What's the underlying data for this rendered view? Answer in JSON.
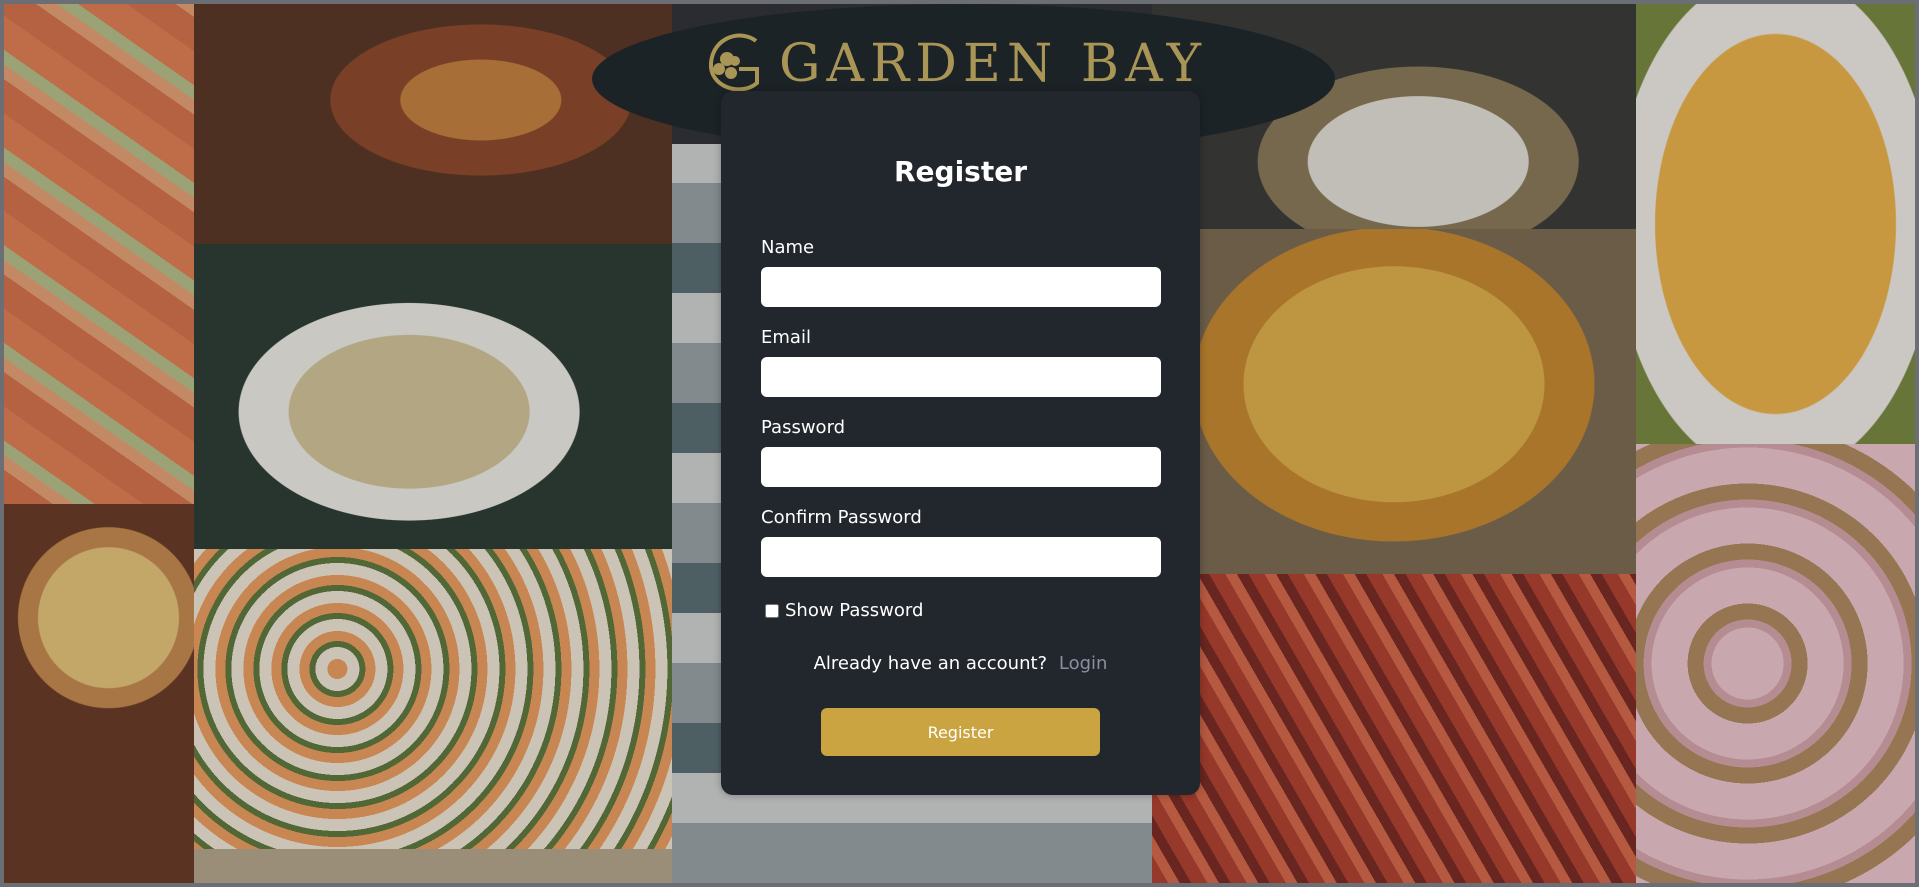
{
  "brand": {
    "name": "GARDEN BAY",
    "logo_icon": "flower-g-monogram-icon",
    "color": "#a99556"
  },
  "form": {
    "title": "Register",
    "fields": [
      {
        "label": "Name",
        "value": ""
      },
      {
        "label": "Email",
        "value": ""
      },
      {
        "label": "Password",
        "value": ""
      },
      {
        "label": "Confirm Password",
        "value": ""
      }
    ],
    "show_password_label": "Show Password",
    "show_password_checked": false,
    "account_prompt": "Already have an account?",
    "login_link": "Login",
    "submit_label": "Register"
  },
  "colors": {
    "card_bg": "#22262d",
    "button": "#c9a440",
    "link": "#8c8fa2"
  }
}
